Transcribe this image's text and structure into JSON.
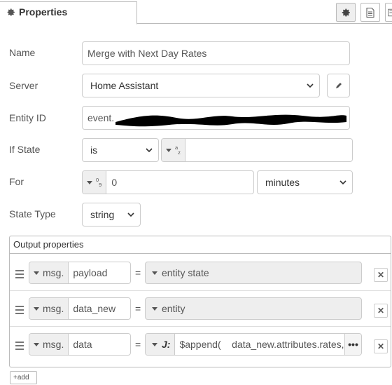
{
  "header": {
    "tab_title": "Properties",
    "buttons": [
      {
        "icon": "gear-icon"
      },
      {
        "icon": "document-icon"
      },
      {
        "icon": "book-icon"
      }
    ]
  },
  "form": {
    "name": {
      "label": "Name",
      "value": "Merge with Next Day Rates"
    },
    "server": {
      "label": "Server",
      "value": "Home Assistant"
    },
    "entity_id": {
      "label": "Entity ID",
      "value": "event."
    },
    "if_state": {
      "label": "If State",
      "operator": "is",
      "type_glyph": "a-z",
      "value": ""
    },
    "for": {
      "label": "For",
      "value": "0",
      "unit": "minutes"
    },
    "state_type": {
      "label": "State Type",
      "value": "string"
    }
  },
  "output_properties": {
    "title": "Output properties",
    "rows": [
      {
        "prefix": "msg.",
        "property": "payload",
        "value_type": "entity state",
        "value": ""
      },
      {
        "prefix": "msg.",
        "property": "data_new",
        "value_type": "entity",
        "value": ""
      },
      {
        "prefix": "msg.",
        "property": "data",
        "value_type": "J:",
        "value": "$append(    data_new.attributes.rates,"
      }
    ],
    "add_label": "add"
  },
  "colors": {
    "border": "#cccccc",
    "panel_border": "#bbbbbb",
    "readonly_bg": "#eeeeee",
    "text": "#555555"
  }
}
